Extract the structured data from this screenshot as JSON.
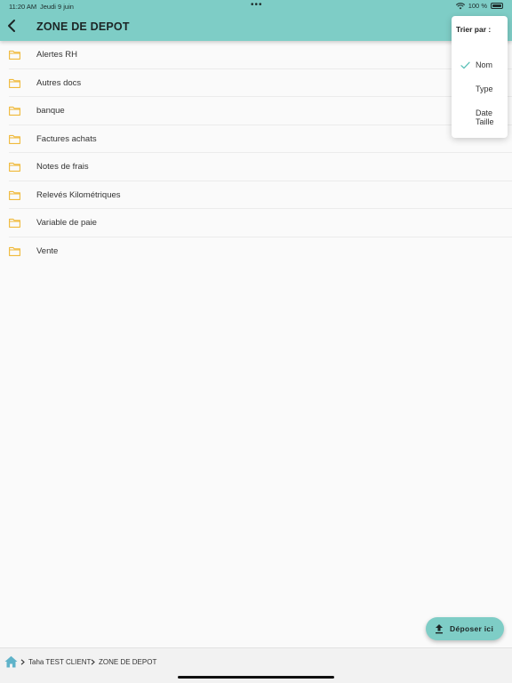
{
  "status_bar": {
    "time": "11:20 AM",
    "date": "Jeudi 9 juin",
    "dots": "•••",
    "battery": "100 %"
  },
  "header": {
    "title": "ZONE DE DEPOT"
  },
  "folders": [
    {
      "label": "Alertes RH"
    },
    {
      "label": "Autres docs"
    },
    {
      "label": "banque"
    },
    {
      "label": "Factures achats"
    },
    {
      "label": "Notes de frais"
    },
    {
      "label": "Relevés Kilométriques"
    },
    {
      "label": "Variable de paie"
    },
    {
      "label": "Vente"
    }
  ],
  "sort_menu": {
    "title": "Trier par :",
    "options": [
      {
        "label": "Nom",
        "selected": true
      },
      {
        "label": "Type",
        "selected": false
      },
      {
        "label": "Date",
        "selected": false
      },
      {
        "label": "Taille",
        "selected": false
      }
    ]
  },
  "deposit_button": {
    "label": "Déposer ici"
  },
  "breadcrumb": {
    "items": [
      "Taha TEST CLIENT",
      "ZONE DE DEPOT"
    ]
  },
  "colors": {
    "accent": "#7ecdc6",
    "folder": "#f0b93a",
    "check": "#5cc1b8"
  },
  "icons": {
    "back": "chevron-left-icon",
    "folder": "folder-icon",
    "check": "check-icon",
    "upload": "upload-icon",
    "home": "home-icon",
    "wifi": "wifi-icon",
    "battery": "battery-icon"
  }
}
